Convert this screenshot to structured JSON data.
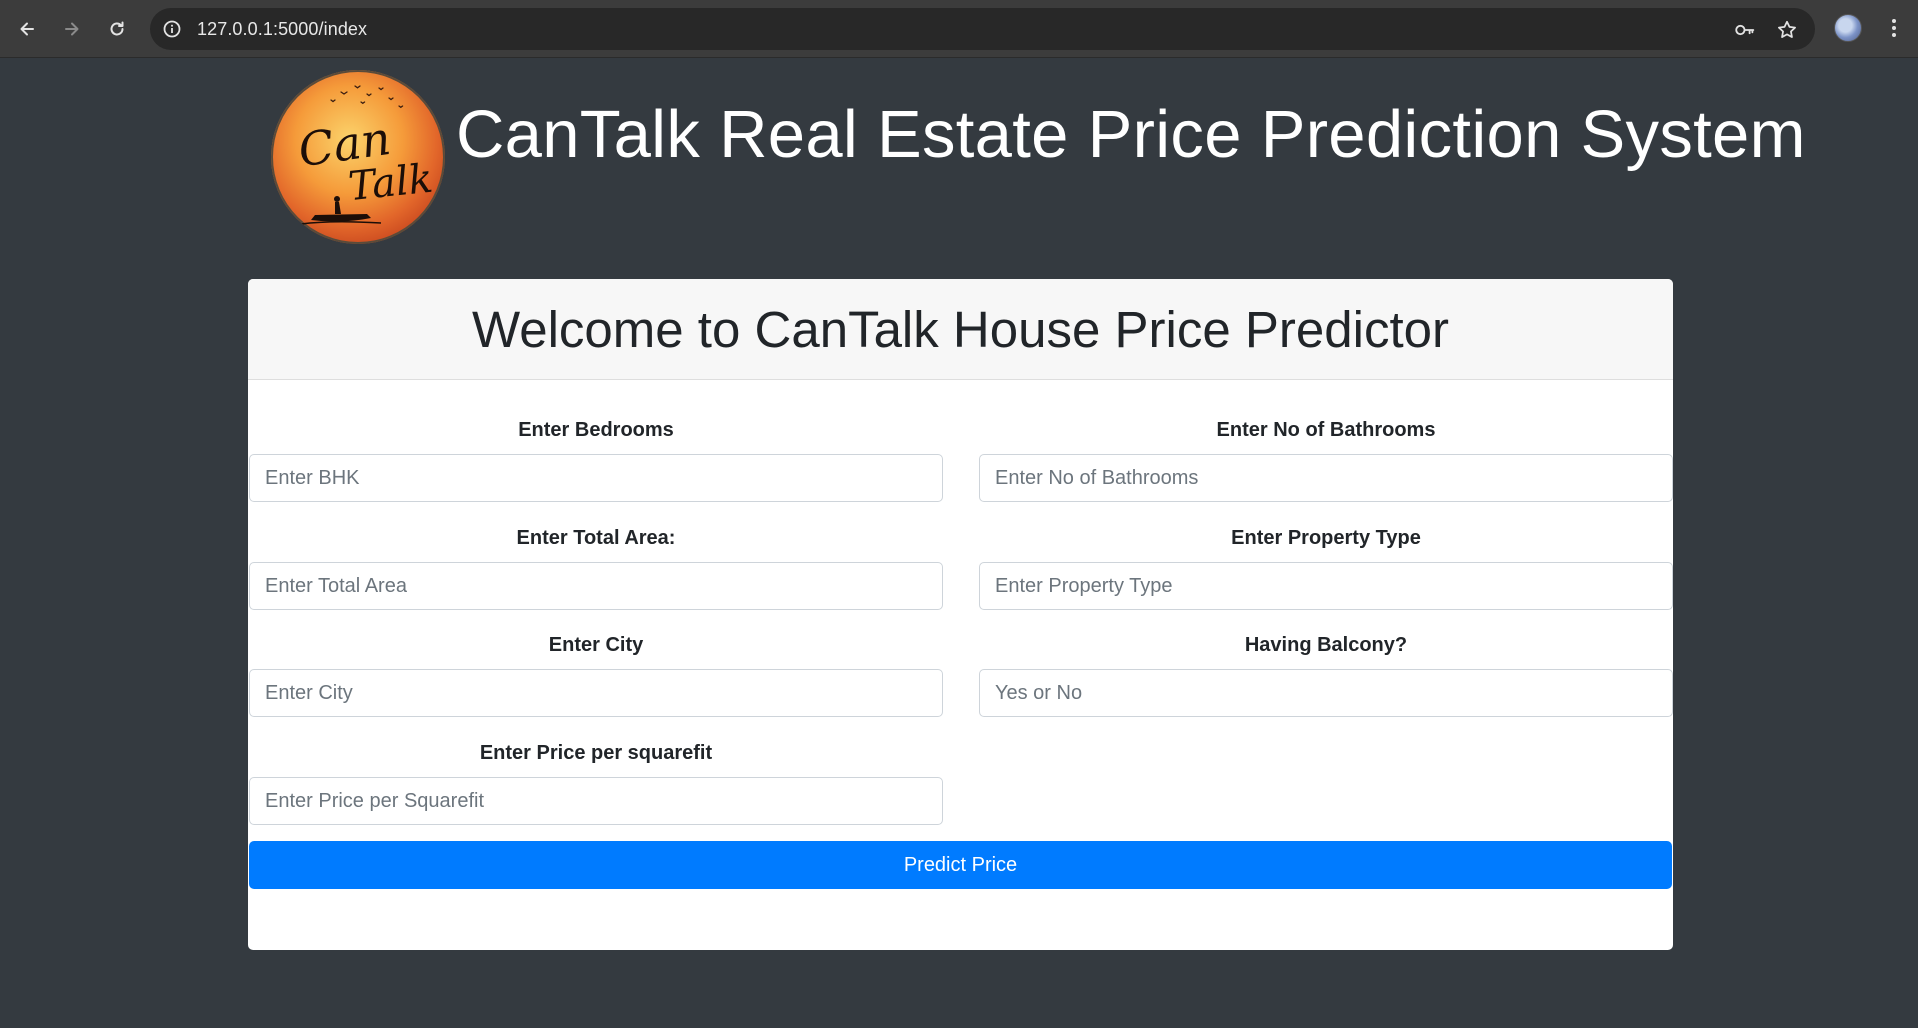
{
  "browser": {
    "url": "127.0.0.1:5000/index",
    "icons": [
      "back-arrow-icon",
      "forward-arrow-icon",
      "reload-icon",
      "site-info-icon",
      "password-key-icon",
      "bookmark-star-icon",
      "profile-avatar",
      "kebab-menu-icon"
    ]
  },
  "header": {
    "title": "CanTalk Real Estate Price Prediction System",
    "logo_text": "Can Talk"
  },
  "card": {
    "heading": "Welcome to CanTalk House Price Predictor",
    "fields": [
      {
        "label": "Enter Bedrooms",
        "placeholder": "Enter BHK",
        "value": ""
      },
      {
        "label": "Enter No of Bathrooms",
        "placeholder": "Enter No of Bathrooms",
        "value": ""
      },
      {
        "label": "Enter Total Area:",
        "placeholder": "Enter Total Area",
        "value": ""
      },
      {
        "label": "Enter Property Type",
        "placeholder": "Enter Property Type",
        "value": ""
      },
      {
        "label": "Enter City",
        "placeholder": "Enter City",
        "value": ""
      },
      {
        "label": "Having Balcony?",
        "placeholder": "Yes or No",
        "value": ""
      },
      {
        "label": "Enter Price per squarefit",
        "placeholder": "Enter Price per Squarefit",
        "value": ""
      }
    ],
    "submit_label": "Predict Price"
  },
  "colors": {
    "page_bg": "#343a40",
    "primary_button": "#007bff",
    "card_header_bg": "#f7f7f7"
  }
}
